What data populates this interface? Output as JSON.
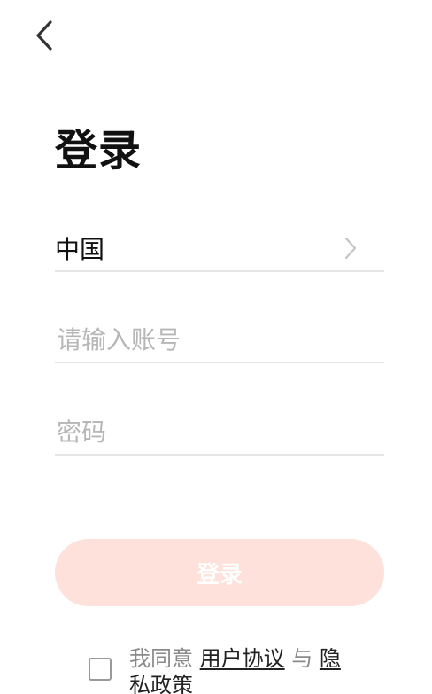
{
  "header": {
    "back_icon": "chevron-left-icon"
  },
  "title": "登录",
  "region": {
    "label": "中国",
    "chevron_icon": "chevron-right-icon"
  },
  "account": {
    "placeholder": "请输入账号",
    "value": ""
  },
  "password": {
    "placeholder": "密码",
    "value": ""
  },
  "login_button": {
    "label": "登录",
    "color": "#fde1da"
  },
  "agreement": {
    "checked": false,
    "prefix": "我同意 ",
    "user_agreement": "用户协议",
    "joiner": " 与 ",
    "privacy_policy": "隐私政策"
  }
}
